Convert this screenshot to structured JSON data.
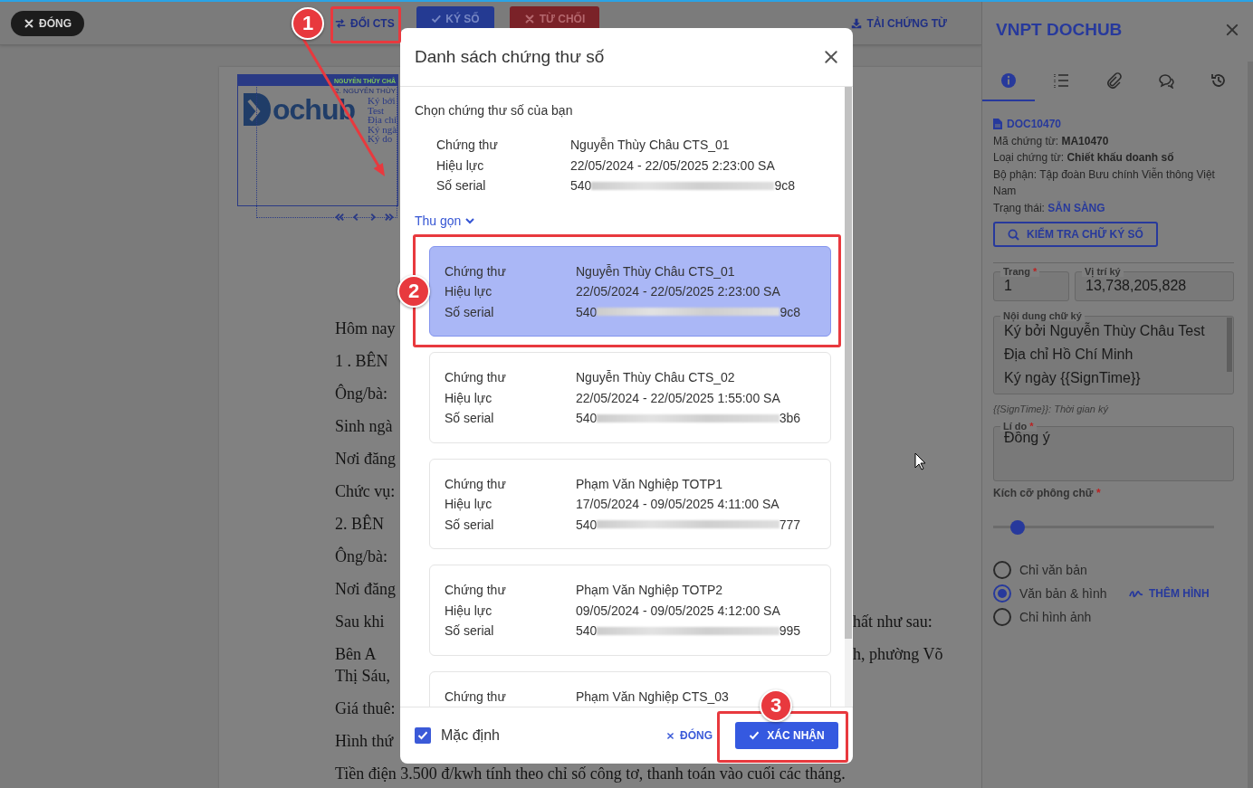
{
  "toolbar": [
    {
      "kind": "close",
      "label": "ĐÓNG"
    },
    {
      "kind": "switch",
      "label": "ĐỔI CTS"
    },
    {
      "kind": "sign",
      "label": "KÝ SỐ"
    },
    {
      "kind": "reject",
      "label": "TỪ CHỐI"
    },
    {
      "kind": "download",
      "label": "TẢI CHỨNG TỪ"
    }
  ],
  "document": {
    "stamp": {
      "header": "NGUYỄN THÙY CHÂ",
      "subheader": "2. NGUYỄN THÙY",
      "logo_text": "ochub",
      "lines": [
        "Ký bởi",
        "Test",
        "Địa chỉ",
        "Ký ngà",
        "Ký do"
      ]
    },
    "lines": [
      {
        "kind": "split",
        "left": "Hôm nay"
      },
      {
        "kind": "split",
        "left": "1 . BÊN"
      },
      {
        "kind": "split",
        "left": "Ông/bà:"
      },
      {
        "kind": "split",
        "left": "Sinh ngà"
      },
      {
        "kind": "split",
        "left": "Nơi đăng"
      },
      {
        "kind": "split",
        "left": "Chức vụ:"
      },
      {
        "kind": "split",
        "left": "2. BÊN"
      },
      {
        "kind": "split",
        "left": "Ông/bà:"
      },
      {
        "kind": "split",
        "left": "Nơi đăng"
      },
      {
        "kind": "split",
        "left": "Sau khi",
        "right": "hất như sau:"
      },
      {
        "kind": "split",
        "left": "Bên A",
        "right": "h, phường Võ"
      },
      {
        "kind": "wrap",
        "left": "Thị Sáu,"
      },
      {
        "kind": "split",
        "left": "Giá thuê:"
      },
      {
        "kind": "split",
        "left": "Hình thứ"
      },
      {
        "kind": "full",
        "left": "Tiền điện 3.500 đ/kwh tính theo chỉ số công tơ, thanh toán vào cuối các tháng."
      }
    ]
  },
  "sidebar": {
    "title": "VNPT DOCHUB",
    "tabs": [
      {
        "kind": "info",
        "selected": true
      },
      {
        "kind": "list",
        "selected": false
      },
      {
        "kind": "attachment",
        "selected": false
      },
      {
        "kind": "comments",
        "selected": false
      },
      {
        "kind": "history",
        "selected": false
      }
    ],
    "doc_code": "DOC10470",
    "info": [
      {
        "kind": "text",
        "text": "Mã chứng từ: **MA10470**"
      },
      {
        "kind": "text",
        "text": "Loại chứng từ: **Chiết khấu doanh số**"
      },
      {
        "kind": "text",
        "text": "Bộ phận: Tập đoàn Bưu chính Viễn thông Việt Nam"
      },
      {
        "kind": "status",
        "label": "Trạng thái:",
        "value": "SẴN SÀNG"
      }
    ],
    "check_button": "KIỂM TRA CHỮ KÝ SỐ",
    "page_field": {
      "label": "Trang",
      "required_mark": "*",
      "value": "1"
    },
    "position_field": {
      "label": "Vị trí ký",
      "value": "13,738,205,828"
    },
    "content_field": {
      "label": "Nội dung chữ ký",
      "lines": [
        "Ký bởi Nguyễn Thùy Châu Test",
        "Địa chỉ Hồ Chí Minh",
        "Ký ngày {{SignTime}}"
      ]
    },
    "hint": "{{SignTime}}: Thời gian ký",
    "reason_field": {
      "label": "Lí do",
      "required_mark": "*",
      "value": "Đồng ý"
    },
    "font_size": {
      "label": "Kích cỡ phông chữ",
      "required_mark": "*",
      "level": 0.11
    },
    "display_options": [
      {
        "label": "Chỉ văn bản",
        "selected": false
      },
      {
        "label": "Văn bản & hình",
        "selected": true
      },
      {
        "label": "Chỉ hình ảnh",
        "selected": false
      }
    ],
    "add_image_button": "THÊM HÌNH"
  },
  "dialog": {
    "title": "Danh sách chứng thư số",
    "prompt": "Chọn chứng thư số của bạn",
    "current": [
      {
        "label": "Chứng thư",
        "value": "Nguyễn Thùy Châu CTS_01"
      },
      {
        "label": "Hiệu lực",
        "value": "22/05/2024 - 22/05/2025 2:23:00 SA"
      },
      {
        "label": "Số serial",
        "value": "540",
        "value_end": "9c8"
      }
    ],
    "toggle": "Thu gọn",
    "certificates": [
      {
        "selected": true,
        "rows": [
          {
            "label": "Chứng thư",
            "value": "Nguyễn Thùy Châu CTS_01"
          },
          {
            "label": "Hiệu lực",
            "value": "22/05/2024 - 22/05/2025 2:23:00 SA"
          },
          {
            "label": "Số serial",
            "value": "540",
            "value_end": "9c8"
          }
        ]
      },
      {
        "selected": false,
        "rows": [
          {
            "label": "Chứng thư",
            "value": "Nguyễn Thùy Châu CTS_02"
          },
          {
            "label": "Hiệu lực",
            "value": "22/05/2024 - 22/05/2025 1:55:00 SA"
          },
          {
            "label": "Số serial",
            "value": "540",
            "value_end": "3b6"
          }
        ]
      },
      {
        "selected": false,
        "rows": [
          {
            "label": "Chứng thư",
            "value": "Phạm Văn Nghiệp TOTP1"
          },
          {
            "label": "Hiệu lực",
            "value": "17/05/2024 - 09/05/2025 4:11:00 SA"
          },
          {
            "label": "Số serial",
            "value": "540",
            "value_end": "777"
          }
        ]
      },
      {
        "selected": false,
        "rows": [
          {
            "label": "Chứng thư",
            "value": "Phạm Văn Nghiệp TOTP2"
          },
          {
            "label": "Hiệu lực",
            "value": "09/05/2024 - 09/05/2025 4:12:00 SA"
          },
          {
            "label": "Số serial",
            "value": "540",
            "value_end": "995"
          }
        ]
      },
      {
        "selected": false,
        "rows": [
          {
            "label": "Chứng thư",
            "value": "Phạm Văn Nghiệp CTS_03"
          }
        ]
      }
    ],
    "default_checkbox": {
      "label": "Mặc định",
      "checked": true
    },
    "cancel_button": "ĐÓNG",
    "confirm_button": "XÁC NHẬN"
  },
  "annotations": [
    {
      "label": "1"
    },
    {
      "label": "2"
    },
    {
      "label": "3"
    }
  ]
}
